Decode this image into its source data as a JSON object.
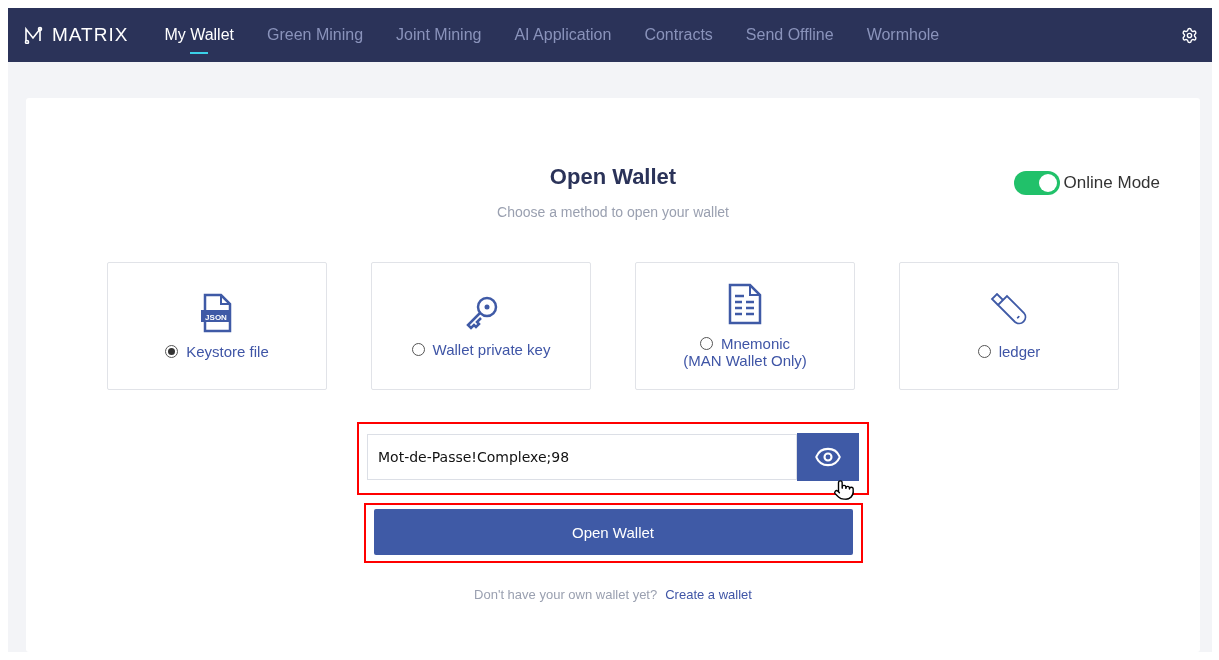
{
  "nav": {
    "logo": "MATRIX",
    "items": [
      {
        "label": "My Wallet",
        "selected": true
      },
      {
        "label": "Green Mining",
        "selected": false
      },
      {
        "label": "Joint Mining",
        "selected": false
      },
      {
        "label": "AI Application",
        "selected": false
      },
      {
        "label": "Contracts",
        "selected": false
      },
      {
        "label": "Send Offline",
        "selected": false
      },
      {
        "label": "Wormhole",
        "selected": false
      }
    ]
  },
  "header": {
    "title": "Open Wallet",
    "subtitle": "Choose a method to open your wallet",
    "toggle": {
      "label": "Online Mode",
      "on": true
    }
  },
  "methods": [
    {
      "kind": "json",
      "icon_text": "JSON",
      "label": "Keystore file",
      "selected": true
    },
    {
      "kind": "key",
      "label": "Wallet private key",
      "selected": false
    },
    {
      "kind": "doc",
      "label": "Mnemonic",
      "note": "(MAN Wallet Only)",
      "selected": false
    },
    {
      "kind": "usb",
      "label": "ledger",
      "selected": false
    }
  ],
  "password": {
    "value": "Mot-de-Passe!Complexe;98"
  },
  "open_button": "Open Wallet",
  "footer": {
    "prompt": "Don't have your own wallet yet?",
    "link": "Create a wallet"
  }
}
